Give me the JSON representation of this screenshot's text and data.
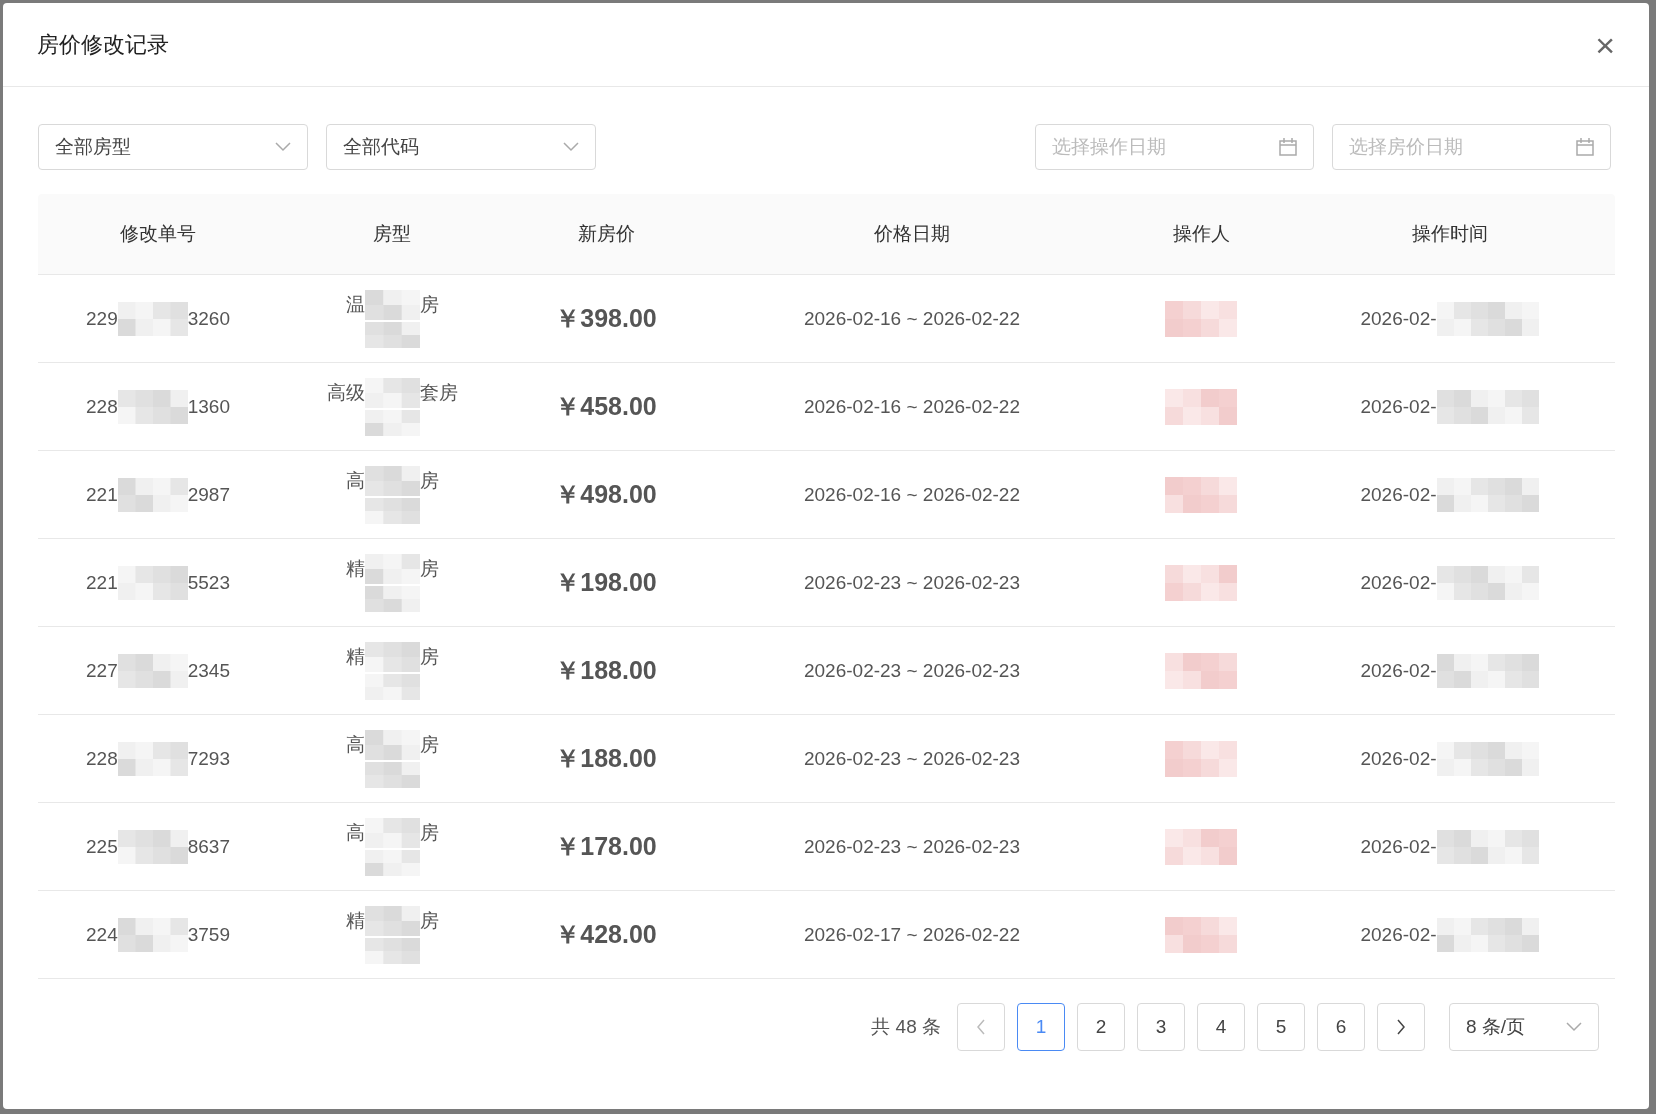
{
  "dialog": {
    "title": "房价修改记录",
    "close": "×"
  },
  "filters": {
    "selects": [
      {
        "value": "全部房型"
      },
      {
        "value": "全部代码"
      }
    ],
    "dates": [
      {
        "placeholder": "选择操作日期"
      },
      {
        "placeholder": "选择房价日期"
      }
    ]
  },
  "table": {
    "columns": [
      "修改单号",
      "房型",
      "新房价",
      "价格日期",
      "操作人",
      "操作时间"
    ],
    "rows": [
      {
        "id_start": "229",
        "id_end": "3260",
        "room_start": "温",
        "room_end": "房",
        "price": "￥398.00",
        "dates": "2026-02-16 ~ 2026-02-22",
        "time_start": "2026-02-"
      },
      {
        "id_start": "228",
        "id_end": "1360",
        "room_start": "高级",
        "room_end": "套房",
        "price": "￥458.00",
        "dates": "2026-02-16 ~ 2026-02-22",
        "time_start": "2026-02-"
      },
      {
        "id_start": "221",
        "id_end": "2987",
        "room_start": "高",
        "room_end": "房",
        "price": "￥498.00",
        "dates": "2026-02-16 ~ 2026-02-22",
        "time_start": "2026-02-"
      },
      {
        "id_start": "221",
        "id_end": "5523",
        "room_start": "精",
        "room_end": "房",
        "price": "￥198.00",
        "dates": "2026-02-23 ~ 2026-02-23",
        "time_start": "2026-02-"
      },
      {
        "id_start": "227",
        "id_end": "2345",
        "room_start": "精",
        "room_end": "房",
        "price": "￥188.00",
        "dates": "2026-02-23 ~ 2026-02-23",
        "time_start": "2026-02-"
      },
      {
        "id_start": "228",
        "id_end": "7293",
        "room_start": "高",
        "room_end": "房",
        "price": "￥188.00",
        "dates": "2026-02-23 ~ 2026-02-23",
        "time_start": "2026-02-"
      },
      {
        "id_start": "225",
        "id_end": "8637",
        "room_start": "高",
        "room_end": "房",
        "price": "￥178.00",
        "dates": "2026-02-23 ~ 2026-02-23",
        "time_start": "2026-02-"
      },
      {
        "id_start": "224",
        "id_end": "3759",
        "room_start": "精",
        "room_end": "房",
        "price": "￥428.00",
        "dates": "2026-02-17 ~ 2026-02-22",
        "time_start": "2026-02-"
      }
    ]
  },
  "pagination": {
    "total": "共 48 条",
    "prev_disabled": true,
    "pages": [
      {
        "label": "1",
        "selected": true
      },
      {
        "label": "2",
        "selected": false
      },
      {
        "label": "3",
        "selected": false
      },
      {
        "label": "4",
        "selected": false
      },
      {
        "label": "5",
        "selected": false
      },
      {
        "label": "6",
        "selected": false
      }
    ],
    "page_size": "8 条/页"
  }
}
